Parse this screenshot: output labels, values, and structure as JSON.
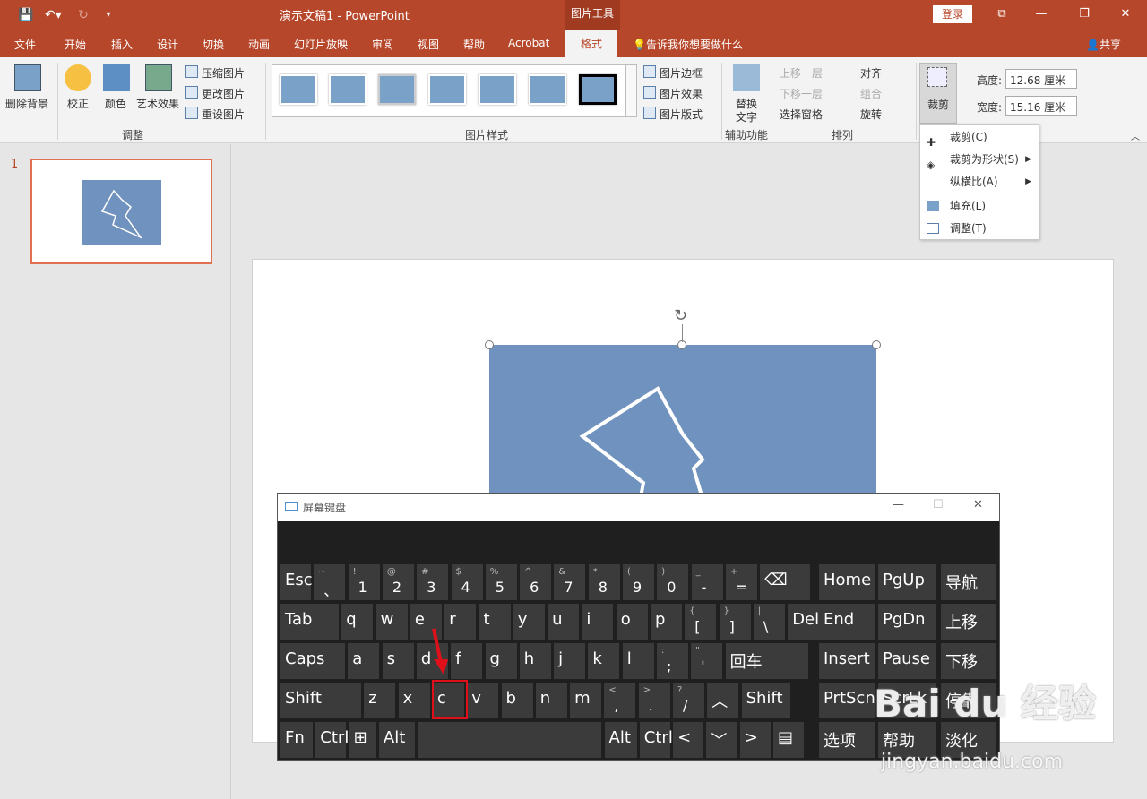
{
  "window": {
    "title": "演示文稿1  -  PowerPoint",
    "tools_label": "图片工具",
    "login": "登录"
  },
  "tabs": [
    "文件",
    "开始",
    "插入",
    "设计",
    "切换",
    "动画",
    "幻灯片放映",
    "审阅",
    "视图",
    "帮助",
    "Acrobat",
    "格式"
  ],
  "tell_me": "告诉我你想要做什么",
  "share": "共享",
  "ribbon": {
    "remove_bg": "删除背景",
    "correct": "校正",
    "color": "颜色",
    "art_effect": "艺术效果",
    "compress": "压缩图片",
    "change": "更改图片",
    "reset": "重设图片",
    "group_adjust": "调整",
    "group_styles": "图片样式",
    "border": "图片边框",
    "effect": "图片效果",
    "layout": "图片版式",
    "alt_text": "替换\n文字",
    "alt_text_1": "替换",
    "alt_text_2": "文字",
    "group_accessibility": "辅助功能",
    "bring_forward": "上移一层",
    "send_backward": "下移一层",
    "selection_pane": "选择窗格",
    "align": "对齐",
    "group": "组合",
    "rotate": "旋转",
    "group_arrange": "排列",
    "crop": "裁剪",
    "height_label": "高度:",
    "height_value": "12.68 厘米",
    "width_label": "宽度:",
    "width_value": "15.16 厘米"
  },
  "crop_menu": [
    "裁剪(C)",
    "裁剪为形状(S)",
    "纵横比(A)",
    "填充(L)",
    "调整(T)"
  ],
  "slide_number": "1",
  "osk": {
    "title": "屏幕键盘",
    "rows": [
      [
        {
          "m": "Esc"
        },
        {
          "s": "~",
          "b": "、"
        },
        {
          "s": "!",
          "b": "1"
        },
        {
          "s": "@",
          "b": "2"
        },
        {
          "s": "#",
          "b": "3"
        },
        {
          "s": "$",
          "b": "4"
        },
        {
          "s": "%",
          "b": "5"
        },
        {
          "s": "^",
          "b": "6"
        },
        {
          "s": "&",
          "b": "7"
        },
        {
          "s": "*",
          "b": "8"
        },
        {
          "s": "(",
          "b": "9"
        },
        {
          "s": ")",
          "b": "0"
        },
        {
          "s": "_",
          "b": "-"
        },
        {
          "s": "+",
          "b": "="
        },
        {
          "m": "⌫"
        }
      ],
      [
        {
          "m": "Tab"
        },
        {
          "m": "q"
        },
        {
          "m": "w"
        },
        {
          "m": "e"
        },
        {
          "m": "r"
        },
        {
          "m": "t"
        },
        {
          "m": "y"
        },
        {
          "m": "u"
        },
        {
          "m": "i"
        },
        {
          "m": "o"
        },
        {
          "m": "p"
        },
        {
          "s": "{",
          "b": "["
        },
        {
          "s": "}",
          "b": "]"
        },
        {
          "s": "|",
          "b": "\\"
        },
        {
          "m": "Del"
        }
      ],
      [
        {
          "m": "Caps"
        },
        {
          "m": "a"
        },
        {
          "m": "s"
        },
        {
          "m": "d"
        },
        {
          "m": "f"
        },
        {
          "m": "g"
        },
        {
          "m": "h"
        },
        {
          "m": "j"
        },
        {
          "m": "k"
        },
        {
          "m": "l"
        },
        {
          "s": ":",
          "b": ";"
        },
        {
          "s": "\"",
          "b": "'"
        },
        {
          "m": "回车"
        }
      ],
      [
        {
          "m": "Shift"
        },
        {
          "m": "z"
        },
        {
          "m": "x"
        },
        {
          "m": "c"
        },
        {
          "m": "v"
        },
        {
          "m": "b"
        },
        {
          "m": "n"
        },
        {
          "m": "m"
        },
        {
          "s": "<",
          "b": ","
        },
        {
          "s": ">",
          "b": "."
        },
        {
          "s": "?",
          "b": "/"
        },
        {
          "m": "︿"
        },
        {
          "m": "Shift"
        }
      ],
      [
        {
          "m": "Fn"
        },
        {
          "m": "Ctrl"
        },
        {
          "m": "⊞"
        },
        {
          "m": "Alt"
        },
        {
          "m": ""
        },
        {
          "m": "Alt"
        },
        {
          "m": "Ctrl"
        },
        {
          "m": "<"
        },
        {
          "m": "﹀"
        },
        {
          "m": ">"
        },
        {
          "m": "▤"
        }
      ]
    ],
    "nav": [
      [
        "Home",
        "PgUp",
        "导航"
      ],
      [
        "End",
        "PgDn",
        "上移"
      ],
      [
        "Insert",
        "Pause",
        "下移"
      ],
      [
        "PrtScn",
        "ScrLk",
        "停靠"
      ],
      [
        "选项",
        "帮助",
        "淡化"
      ]
    ]
  },
  "watermark": {
    "logo": "Bai du 经验",
    "url": "jingyan.baidu.com"
  }
}
